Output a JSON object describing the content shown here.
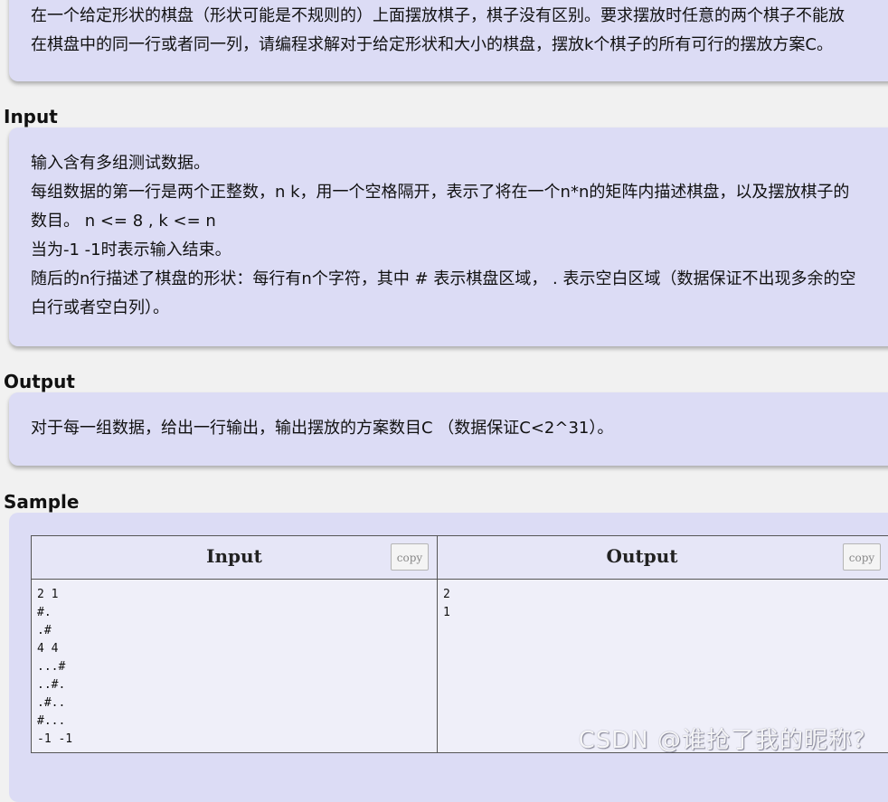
{
  "description": {
    "lines": [
      "在一个给定形状的棋盘（形状可能是不规则的）上面摆放棋子，棋子没有区别。要求摆放时任意的两个棋子不能放",
      "在棋盘中的同一行或者同一列，请编程求解对于给定形状和大小的棋盘，摆放k个棋子的所有可行的摆放方案C。"
    ]
  },
  "input_section": {
    "title": "Input",
    "lines": [
      "输入含有多组测试数据。",
      "每组数据的第一行是两个正整数，n k，用一个空格隔开，表示了将在一个n*n的矩阵内描述棋盘，以及摆放棋子的",
      "数目。 n <= 8 , k <= n",
      "当为-1 -1时表示输入结束。",
      "随后的n行描述了棋盘的形状：每行有n个字符，其中 # 表示棋盘区域， . 表示空白区域（数据保证不出现多余的空",
      "白行或者空白列）。"
    ]
  },
  "output_section": {
    "title": "Output",
    "lines": [
      "对于每一组数据，给出一行输出，输出摆放的方案数目C （数据保证C<2^31）。"
    ]
  },
  "sample_section": {
    "title": "Sample",
    "input_header": "Input",
    "output_header": "Output",
    "copy_label": "copy",
    "input_text": "2 1\n#.\n.#\n4 4\n...#\n..#.\n.#..\n#...\n-1 -1",
    "output_text": "2\n1"
  },
  "watermark": "CSDN @谁抢了我的昵称？"
}
